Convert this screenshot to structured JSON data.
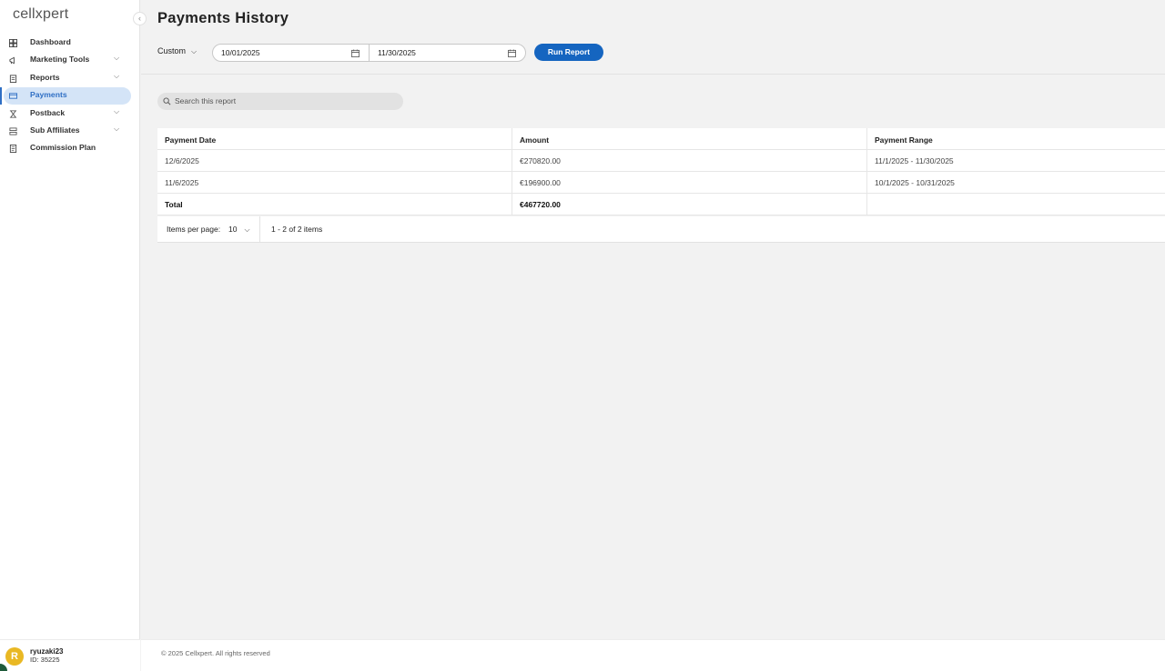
{
  "brand": {
    "logo_text": "cellxpert"
  },
  "sidebar": {
    "collapse_icon": "chevron-left-icon",
    "items": [
      {
        "label": "Dashboard",
        "icon": "dashboard-icon",
        "has_chevron": false
      },
      {
        "label": "Marketing Tools",
        "icon": "megaphone-icon",
        "has_chevron": true
      },
      {
        "label": "Reports",
        "icon": "reports-icon",
        "has_chevron": true
      },
      {
        "label": "Payments",
        "icon": "wallet-icon",
        "has_chevron": false,
        "active": true
      },
      {
        "label": "Postback",
        "icon": "postback-icon",
        "has_chevron": true
      },
      {
        "label": "Sub Affiliates",
        "icon": "sub-affiliates-icon",
        "has_chevron": true
      },
      {
        "label": "Commission Plan",
        "icon": "document-icon",
        "has_chevron": false
      }
    ],
    "chevron": "⌵"
  },
  "user": {
    "initial": "R",
    "name": "ryuzaki23",
    "id_text": "ID: 35225",
    "avatar_color": "#e9b824"
  },
  "page": {
    "title": "Payments History"
  },
  "filters": {
    "range_label": "Custom",
    "start_date": "10/01/2025",
    "end_date": "11/30/2025",
    "run_button": "Run Report",
    "accent_color": "#1565c0"
  },
  "search": {
    "placeholder": "Search this report"
  },
  "table": {
    "headers": [
      "Payment Date",
      "Amount",
      "Payment Range"
    ],
    "rows": [
      [
        "12/6/2025",
        "€270820.00",
        "11/1/2025 - 11/30/2025"
      ],
      [
        "11/6/2025",
        "€196900.00",
        "10/1/2025 - 10/31/2025"
      ]
    ],
    "total": {
      "label": "Total",
      "amount": "€467720.00",
      "range": ""
    }
  },
  "pager": {
    "label": "Items per page:",
    "per_page": "10",
    "info": "1 - 2 of 2 items"
  },
  "footer": {
    "copyright": "© 2025 Cellxpert. All rights reserved"
  }
}
